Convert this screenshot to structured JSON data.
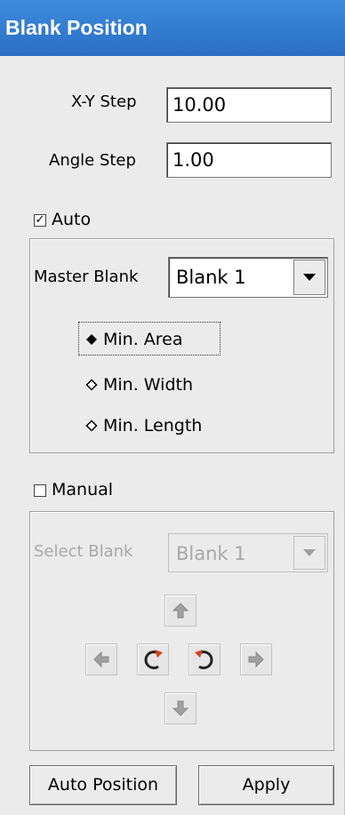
{
  "window": {
    "title": "Blank Position"
  },
  "xy_step": {
    "label": "X-Y Step",
    "value": "10.00"
  },
  "angle_step": {
    "label": "Angle Step",
    "value": "1.00"
  },
  "auto": {
    "label": "Auto",
    "checked": true,
    "master_blank_label": "Master Blank",
    "master_blank_value": "Blank 1",
    "options": [
      {
        "label": "Min. Area",
        "selected": true
      },
      {
        "label": "Min. Width",
        "selected": false
      },
      {
        "label": "Min. Length",
        "selected": false
      }
    ]
  },
  "manual": {
    "label": "Manual",
    "checked": false,
    "select_blank_label": "Select Blank",
    "select_blank_value": "Blank 1",
    "controls": [
      "arrow-up-icon",
      "arrow-left-icon",
      "rotate-clockwise-icon",
      "rotate-counterclockwise-icon",
      "arrow-right-icon",
      "arrow-down-icon"
    ]
  },
  "buttons": {
    "auto_position": "Auto Position",
    "apply": "Apply"
  },
  "colors": {
    "title_bar": "#2f78d0",
    "rotate_accent": "#d2441e",
    "disabled_text": "#a8a8a8"
  }
}
